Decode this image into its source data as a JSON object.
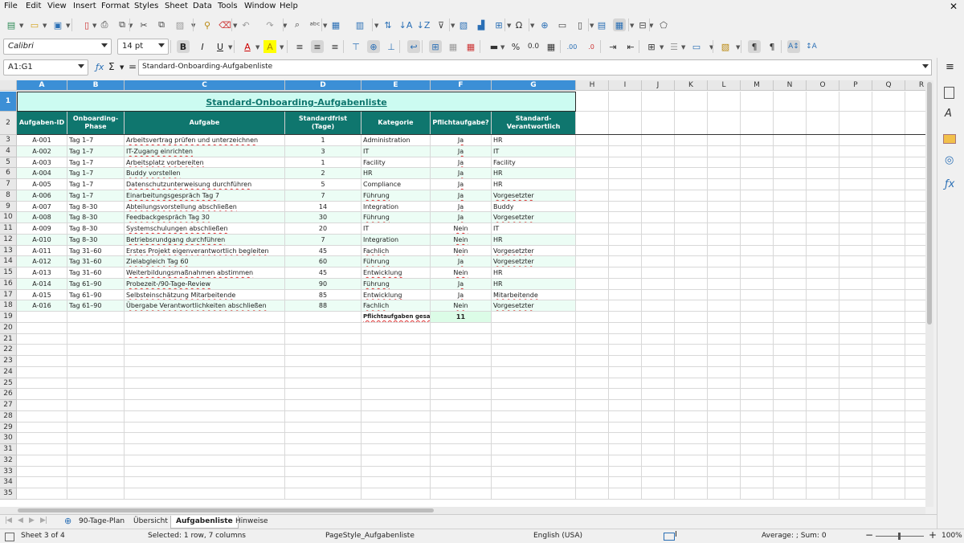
{
  "menu": [
    "File",
    "Edit",
    "View",
    "Insert",
    "Format",
    "Styles",
    "Sheet",
    "Data",
    "Tools",
    "Window",
    "Help"
  ],
  "toolbar": {
    "font_name": "Calibri",
    "font_size": "14 pt"
  },
  "formula_bar": {
    "name_box": "A1:G1",
    "content": "Standard-Onboarding-Aufgabenliste"
  },
  "columns": [
    "A",
    "B",
    "C",
    "D",
    "E",
    "F",
    "G",
    "H",
    "I",
    "J",
    "K",
    "L",
    "M",
    "N",
    "O",
    "P",
    "Q",
    "R"
  ],
  "rows": [
    "1",
    "2",
    "3",
    "4",
    "5",
    "6",
    "7",
    "8",
    "9",
    "10",
    "11",
    "12",
    "13",
    "14",
    "15",
    "16",
    "17",
    "18",
    "19",
    "20",
    "21",
    "22",
    "23",
    "24",
    "25",
    "26",
    "27",
    "28",
    "29",
    "30",
    "31",
    "32",
    "33",
    "34",
    "35"
  ],
  "title": "Standard-Onboarding-Aufgabenliste",
  "headers": [
    "Aufgaben-ID",
    "Onboarding-Phase",
    "Aufgabe",
    "Standardfrist (Tage)",
    "Kategorie",
    "Pflichtaufgabe?",
    "Standard-Verantwortlich"
  ],
  "table": [
    [
      "A-001",
      "Tag 1–7",
      "Arbeitsvertrag prüfen und unterzeichnen",
      "1",
      "Administration",
      "Ja",
      "HR"
    ],
    [
      "A-002",
      "Tag 1–7",
      "IT-Zugang einrichten",
      "3",
      "IT",
      "Ja",
      "IT"
    ],
    [
      "A-003",
      "Tag 1–7",
      "Arbeitsplatz vorbereiten",
      "1",
      "Facility",
      "Ja",
      "Facility"
    ],
    [
      "A-004",
      "Tag 1–7",
      "Buddy vorstellen",
      "2",
      "HR",
      "Ja",
      "HR"
    ],
    [
      "A-005",
      "Tag 1–7",
      "Datenschutzunterweisung durchführen",
      "5",
      "Compliance",
      "Ja",
      "HR"
    ],
    [
      "A-006",
      "Tag 1–7",
      "Einarbeitungsgespräch Tag 7",
      "7",
      "Führung",
      "Ja",
      "Vorgesetzter"
    ],
    [
      "A-007",
      "Tag 8–30",
      "Abteilungsvorstellung abschließen",
      "14",
      "Integration",
      "Ja",
      "Buddy"
    ],
    [
      "A-008",
      "Tag 8–30",
      "Feedbackgespräch Tag 30",
      "30",
      "Führung",
      "Ja",
      "Vorgesetzter"
    ],
    [
      "A-009",
      "Tag 8–30",
      "Systemschulungen abschließen",
      "20",
      "IT",
      "Nein",
      "IT"
    ],
    [
      "A-010",
      "Tag 8–30",
      "Betriebsrundgang durchführen",
      "7",
      "Integration",
      "Nein",
      "HR"
    ],
    [
      "A-011",
      "Tag 31–60",
      "Erstes Projekt eigenverantwortlich begleiten",
      "45",
      "Fachlich",
      "Nein",
      "Vorgesetzter"
    ],
    [
      "A-012",
      "Tag 31–60",
      "Zielabgleich Tag 60",
      "60",
      "Führung",
      "Ja",
      "Vorgesetzter"
    ],
    [
      "A-013",
      "Tag 31–60",
      "Weiterbildungsmaßnahmen abstimmen",
      "45",
      "Entwicklung",
      "Nein",
      "HR"
    ],
    [
      "A-014",
      "Tag 61–90",
      "Probezeit-/90-Tage-Review",
      "90",
      "Führung",
      "Ja",
      "HR"
    ],
    [
      "A-015",
      "Tag 61–90",
      "Selbsteinschätzung Mitarbeitende",
      "85",
      "Entwicklung",
      "Ja",
      "Mitarbeitende"
    ],
    [
      "A-016",
      "Tag 61–90",
      "Übergabe Verantwortlichkeiten abschließen",
      "88",
      "Fachlich",
      "Nein",
      "Vorgesetzter"
    ]
  ],
  "summary": {
    "label": "Pflichtaufgaben gesamt:",
    "value": "11"
  },
  "tabs": [
    "90-Tage-Plan",
    "Übersicht",
    "Aufgabenliste",
    "Hinweise"
  ],
  "active_tab": "Aufgabenliste",
  "status": {
    "sheet": "Sheet 3 of 4",
    "selection": "Selected: 1 row, 7 columns",
    "page_style": "PageStyle_Aufgabenliste",
    "language": "English (USA)",
    "formula": "Average: ; Sum: 0",
    "zoom": "100%"
  },
  "colors": {
    "header_bg": "#0f766e",
    "title_bg": "#ccfbf1",
    "alt_row": "#ecfdf5",
    "summary_bg": "#dcfce7",
    "selection": "#3c8fd6"
  }
}
